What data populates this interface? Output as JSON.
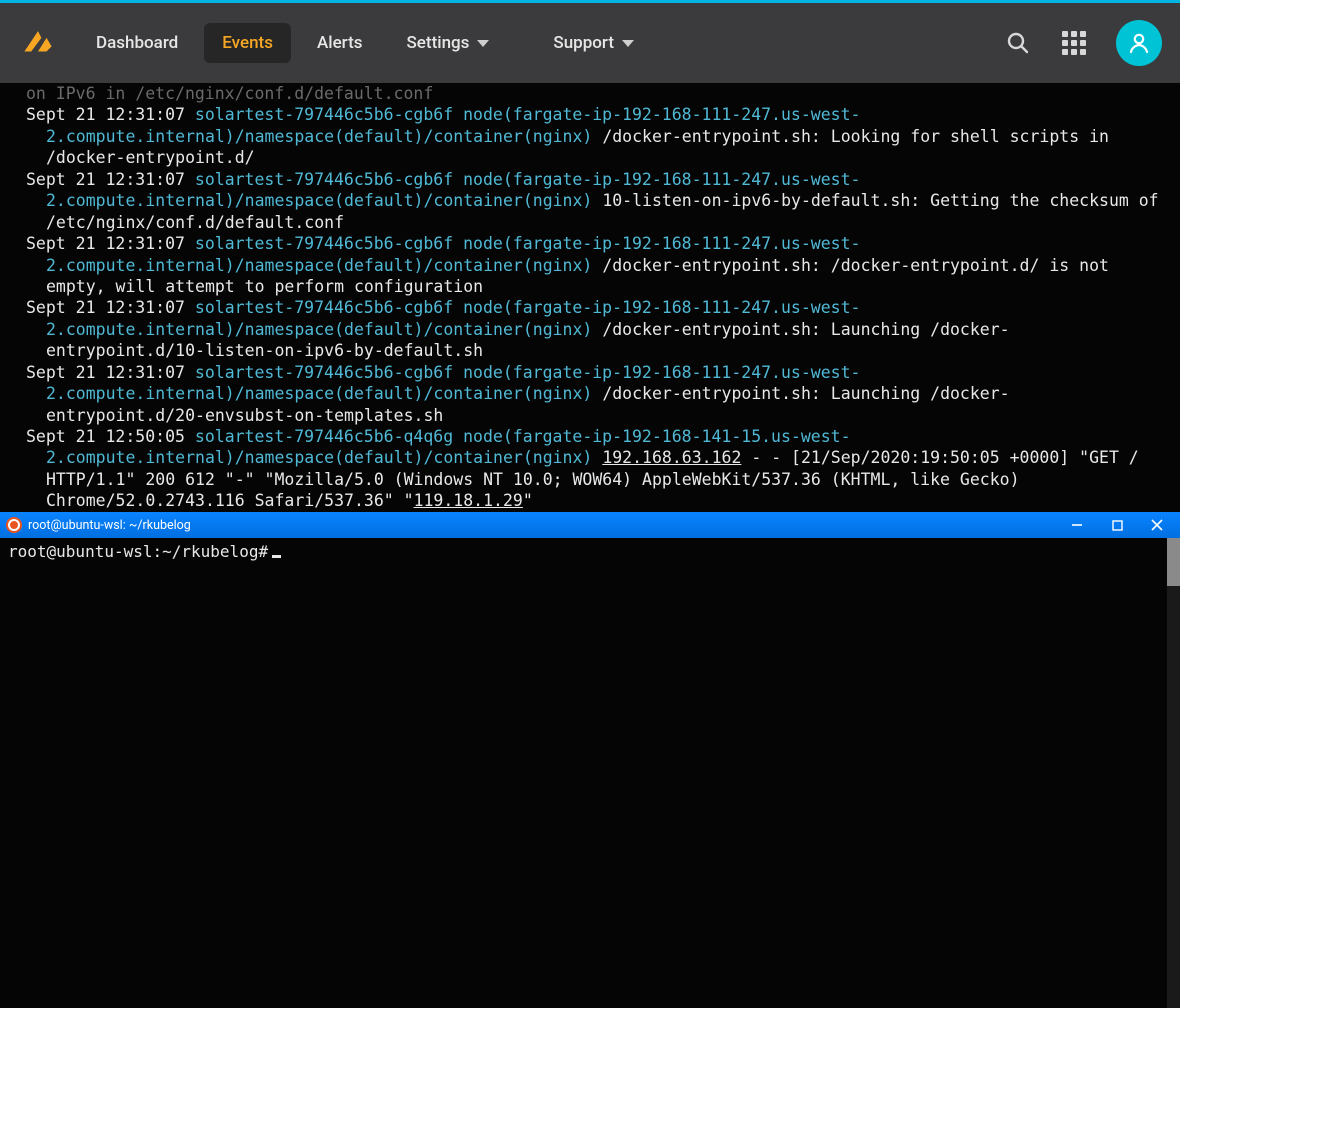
{
  "nav": {
    "items": [
      {
        "label": "Dashboard"
      },
      {
        "label": "Events"
      },
      {
        "label": "Alerts"
      },
      {
        "label": "Settings"
      },
      {
        "label": "Support"
      }
    ]
  },
  "logs": {
    "cutoff_line": "on IPv6 in /etc/nginx/conf.d/default.conf",
    "entries": [
      {
        "ts": "Sept 21 12:31:07",
        "host": "solartest-797446c5b6-cgb6f",
        "ctx": "node(fargate-ip-192-168-111-247.us-west-2.compute.internal)/namespace(default)/container(nginx)",
        "msg": "/docker-entrypoint.sh: Looking for shell scripts in /docker-entrypoint.d/"
      },
      {
        "ts": "Sept 21 12:31:07",
        "host": "solartest-797446c5b6-cgb6f",
        "ctx": "node(fargate-ip-192-168-111-247.us-west-2.compute.internal)/namespace(default)/container(nginx)",
        "msg": "10-listen-on-ipv6-by-default.sh: Getting the checksum of /etc/nginx/conf.d/default.conf"
      },
      {
        "ts": "Sept 21 12:31:07",
        "host": "solartest-797446c5b6-cgb6f",
        "ctx": "node(fargate-ip-192-168-111-247.us-west-2.compute.internal)/namespace(default)/container(nginx)",
        "msg": "/docker-entrypoint.sh: /docker-entrypoint.d/ is not empty, will attempt to perform configuration"
      },
      {
        "ts": "Sept 21 12:31:07",
        "host": "solartest-797446c5b6-cgb6f",
        "ctx": "node(fargate-ip-192-168-111-247.us-west-2.compute.internal)/namespace(default)/container(nginx)",
        "msg": "/docker-entrypoint.sh: Launching /docker-entrypoint.d/10-listen-on-ipv6-by-default.sh"
      },
      {
        "ts": "Sept 21 12:31:07",
        "host": "solartest-797446c5b6-cgb6f",
        "ctx": "node(fargate-ip-192-168-111-247.us-west-2.compute.internal)/namespace(default)/container(nginx)",
        "msg": "/docker-entrypoint.sh: Launching /docker-entrypoint.d/20-envsubst-on-templates.sh"
      },
      {
        "ts": "Sept 21 12:50:05",
        "host": "solartest-797446c5b6-q4q6g",
        "ctx": "node(fargate-ip-192-168-141-15.us-west-2.compute.internal)/namespace(default)/container(nginx)",
        "ip1": "192.168.63.162",
        "mid": " - - [21/Sep/2020:19:50:05 +0000] \"GET / HTTP/1.1\" 200 612 \"-\" \"Mozilla/5.0 (Windows NT 10.0; WOW64) AppleWebKit/537.36 (KHTML, like Gecko) Chrome/52.0.2743.116 Safari/537.36\" \"",
        "ip2": "119.18.1.29",
        "tail": "\""
      }
    ]
  },
  "terminal": {
    "title": "root@ubuntu-wsl: ~/rkubelog",
    "prompt": "root@ubuntu-wsl:~/rkubelog#"
  }
}
